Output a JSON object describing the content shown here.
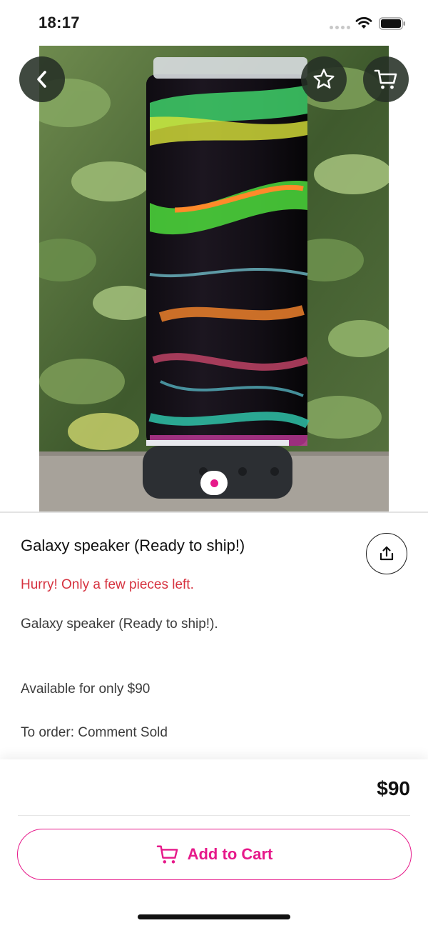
{
  "status_bar": {
    "time": "18:17",
    "icons": [
      "cellular-dots-icon",
      "wifi-icon",
      "battery-icon"
    ]
  },
  "header": {
    "icons": [
      "back-arrow-icon",
      "star-icon",
      "cart-icon"
    ]
  },
  "gallery": {
    "image_description_icon": "product-photo",
    "page_indicator_active": 1,
    "page_indicator_total": 1
  },
  "product": {
    "title": "Galaxy speaker (Ready to ship!)",
    "stock_note": "Hurry! Only a few pieces left.",
    "description_lines": [
      "Galaxy speaker (Ready to ship!).",
      "Available for only $90",
      "To order: Comment Sold"
    ],
    "share_icon": "share-icon"
  },
  "footer": {
    "price": "$90",
    "add_to_cart_label": "Add to Cart",
    "cart_icon": "cart-icon"
  },
  "colors": {
    "accent": "#e6198a",
    "warning": "#d6323f",
    "overlay_button": "#263026"
  }
}
